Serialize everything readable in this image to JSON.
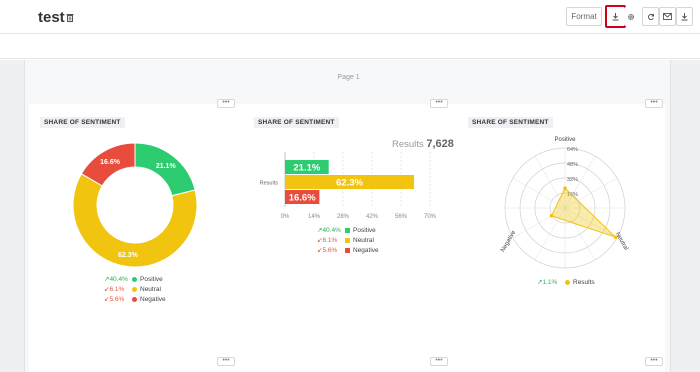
{
  "header": {
    "title": "test",
    "format_label": "Format"
  },
  "page": {
    "label": "Page 1"
  },
  "widgets": {
    "donut": {
      "title": "SHARE OF SENTIMENT"
    },
    "bar": {
      "title": "SHARE OF SENTIMENT",
      "results_label": "Results",
      "results_value": "7,628",
      "category_label": "Results"
    },
    "radar": {
      "title": "SHARE OF SENTIMENT",
      "result_change": "1.1%",
      "result_label": "Results"
    }
  },
  "legend": [
    {
      "change": "40.4%",
      "direction": "up",
      "label": "Positive",
      "color": "#2ecc71"
    },
    {
      "change": "6.1%",
      "direction": "down",
      "label": "Neutral",
      "color": "#f1c40f"
    },
    {
      "change": "5.6%",
      "direction": "down",
      "label": "Negative",
      "color": "#e74c3c"
    }
  ],
  "chart_data": [
    {
      "type": "pie",
      "title": "SHARE OF SENTIMENT",
      "categories": [
        "Positive",
        "Neutral",
        "Negative"
      ],
      "values": [
        21.1,
        62.3,
        16.6
      ],
      "labels": [
        "21.1%",
        "62.3%",
        "16.6%"
      ],
      "colors": [
        "#2ecc71",
        "#f1c40f",
        "#e74c3c"
      ]
    },
    {
      "type": "bar",
      "title": "SHARE OF SENTIMENT",
      "orientation": "horizontal",
      "categories": [
        "Results"
      ],
      "series": [
        {
          "name": "Positive",
          "values": [
            21.1
          ],
          "label": "21.1%",
          "color": "#2ecc71"
        },
        {
          "name": "Neutral",
          "values": [
            62.3
          ],
          "label": "62.3%",
          "color": "#f1c40f"
        },
        {
          "name": "Negative",
          "values": [
            16.6
          ],
          "label": "16.6%",
          "color": "#e74c3c"
        }
      ],
      "xlim": [
        0,
        70
      ],
      "xticks": [
        "0%",
        "14%",
        "28%",
        "42%",
        "56%",
        "70%"
      ],
      "grid": true
    },
    {
      "type": "radar",
      "title": "SHARE OF SENTIMENT",
      "axes": [
        "Positive",
        "Neutral",
        "Negative"
      ],
      "series": [
        {
          "name": "Results",
          "values": [
            21.1,
            62.3,
            16.6
          ],
          "color": "#f1c40f"
        }
      ],
      "rlim": [
        0,
        64
      ],
      "rticks": [
        "16%",
        "32%",
        "48%",
        "64%"
      ]
    }
  ]
}
